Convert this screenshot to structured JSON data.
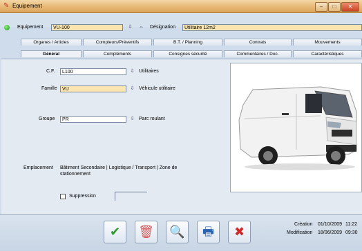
{
  "window": {
    "title": "Equipement",
    "title_icon": "app-wrench-icon",
    "controls": {
      "minimize": "–",
      "maximize": "□",
      "close": "✕"
    }
  },
  "header": {
    "status_color": "#2aa827",
    "equipement_label": "Equipement",
    "equipement_value": "VU-100",
    "designation_label": "Désignation",
    "designation_value": "Utilitaire 12m2"
  },
  "tabs_row1": [
    {
      "label": "Organes / Articles"
    },
    {
      "label": "Compteurs/Préventifs"
    },
    {
      "label": "B.T. / Planning"
    },
    {
      "label": "Contrats"
    },
    {
      "label": "Mouvements"
    }
  ],
  "tabs_row2": [
    {
      "label": "Général",
      "active": true
    },
    {
      "label": "Compléments"
    },
    {
      "label": "Consignes sécurité"
    },
    {
      "label": "Commentaires / Doc."
    },
    {
      "label": "Caractéristiques"
    }
  ],
  "general": {
    "cf_label": "C.F.",
    "cf_value": "L100",
    "cf_desc": "Utilitaires",
    "famille_label": "Famille",
    "famille_value": "VU",
    "famille_desc": "Véhicule utilitaire",
    "groupe_label": "Groupe",
    "groupe_value": "PR",
    "groupe_desc": "Parc roulant",
    "emplacement_label": "Emplacement",
    "emplacement_value": "Bâtiment Secondaire | Logistique / Transport | Zone de stationnement",
    "suppression_label": "Suppression",
    "suppression_checked": false,
    "suppression_date": ""
  },
  "photo": {
    "alt": "van-photo"
  },
  "toolbar": {
    "validate_icon": "checkmark-icon",
    "delete_icon": "trash-icon",
    "search_icon": "magnifier-icon",
    "print_icon": "printer-icon",
    "cancel_icon": "cancel-x-icon"
  },
  "meta": {
    "creation_label": "Création",
    "creation_value": "01/10/2009",
    "creation_time": "11:22",
    "modification_label": "Modification",
    "modification_value": "18/06/2009",
    "modification_time": "09:30"
  }
}
